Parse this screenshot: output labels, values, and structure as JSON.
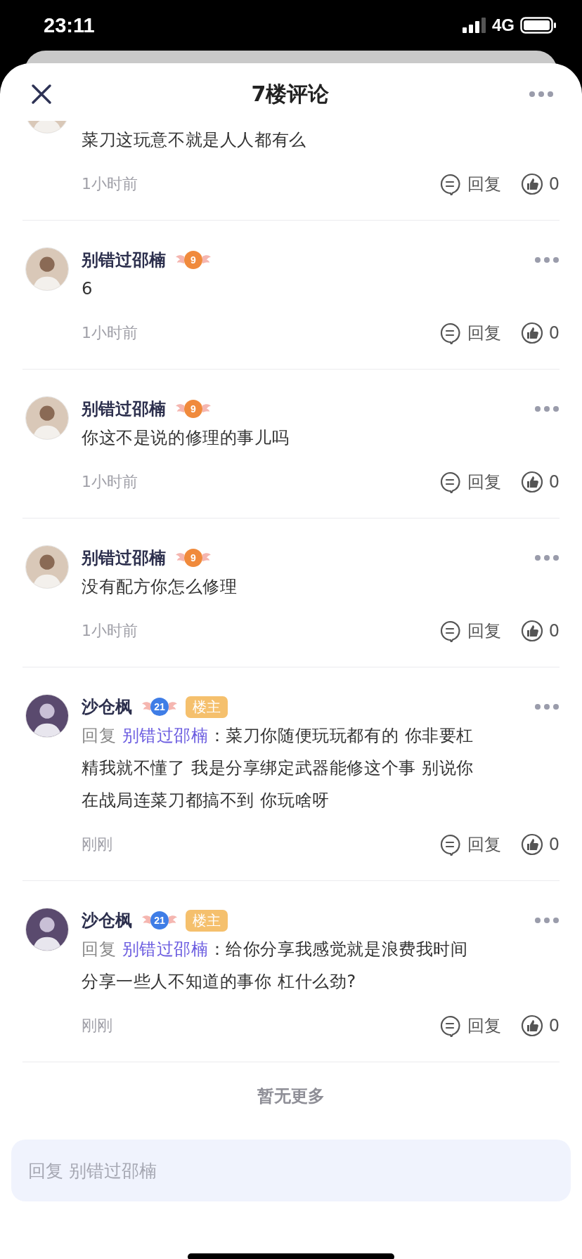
{
  "status_bar": {
    "time": "23:11",
    "network": "4G"
  },
  "header": {
    "title": "7楼评论"
  },
  "comments": [
    {
      "kind": "partial",
      "text": "菜刀这玩意不就是人人都有么",
      "time": "1小时前",
      "reply_label": "回复",
      "likes": "0"
    },
    {
      "kind": "full",
      "author": "别错过邵楠",
      "level": {
        "text": "9",
        "color": "#f08a3c"
      },
      "text": "6",
      "time": "1小时前",
      "reply_label": "回复",
      "likes": "0"
    },
    {
      "kind": "full",
      "author": "别错过邵楠",
      "level": {
        "text": "9",
        "color": "#f08a3c"
      },
      "text": "你这不是说的修理的事儿吗",
      "time": "1小时前",
      "reply_label": "回复",
      "likes": "0"
    },
    {
      "kind": "full",
      "author": "别错过邵楠",
      "level": {
        "text": "9",
        "color": "#f08a3c"
      },
      "text": "没有配方你怎么修理",
      "time": "1小时前",
      "reply_label": "回复",
      "likes": "0"
    },
    {
      "kind": "full",
      "author": "沙仓枫",
      "level": {
        "text": "21",
        "color": "#3f7de6"
      },
      "owner_tag": "楼主",
      "reply_to": {
        "prefix": "回复",
        "name": "别错过邵楠"
      },
      "text": "：菜刀你随便玩玩都有的 你非要杠精我就不懂了 我是分享绑定武器能修这个事 别说你在战局连菜刀都搞不到 你玩啥呀",
      "time": "刚刚",
      "reply_label": "回复",
      "likes": "0"
    },
    {
      "kind": "full",
      "author": "沙仓枫",
      "level": {
        "text": "21",
        "color": "#3f7de6"
      },
      "owner_tag": "楼主",
      "reply_to": {
        "prefix": "回复",
        "name": "别错过邵楠"
      },
      "text": "：给你分享我感觉就是浪费我时间分享一些人不知道的事你 杠什么劲?",
      "time": "刚刚",
      "reply_label": "回复",
      "likes": "0"
    }
  ],
  "footer": {
    "text": "暂无更多"
  },
  "input": {
    "placeholder": "回复 别错过邵楠"
  }
}
